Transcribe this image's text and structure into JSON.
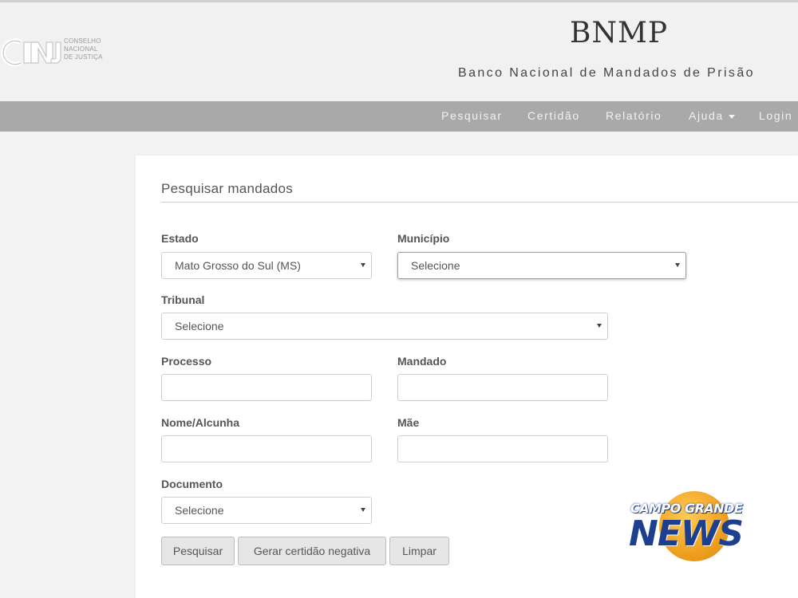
{
  "header": {
    "logo_lines": [
      "CONSELHO",
      "NACIONAL",
      "DE JUSTIÇA"
    ],
    "title": "BNMP",
    "subtitle": "Banco Nacional de Mandados de Prisão"
  },
  "nav": {
    "items": [
      {
        "label": "Pesquisar"
      },
      {
        "label": "Certidão"
      },
      {
        "label": "Relatório"
      },
      {
        "label": "Ajuda"
      },
      {
        "label": "Login"
      }
    ]
  },
  "form": {
    "title": "Pesquisar mandados",
    "estado": {
      "label": "Estado",
      "value": "Mato Grosso do Sul (MS)"
    },
    "municipio": {
      "label": "Município",
      "value": "Selecione"
    },
    "tribunal": {
      "label": "Tribunal",
      "value": "Selecione"
    },
    "processo": {
      "label": "Processo",
      "value": ""
    },
    "mandado": {
      "label": "Mandado",
      "value": ""
    },
    "nome": {
      "label": "Nome/Alcunha",
      "value": ""
    },
    "mae": {
      "label": "Mãe",
      "value": ""
    },
    "documento": {
      "label": "Documento",
      "value": "Selecione"
    },
    "buttons": {
      "search": "Pesquisar",
      "certificate": "Gerar certidão negativa",
      "clear": "Limpar"
    }
  },
  "watermark": {
    "top": "CAMPO GRANDE",
    "main": "NEWS"
  }
}
